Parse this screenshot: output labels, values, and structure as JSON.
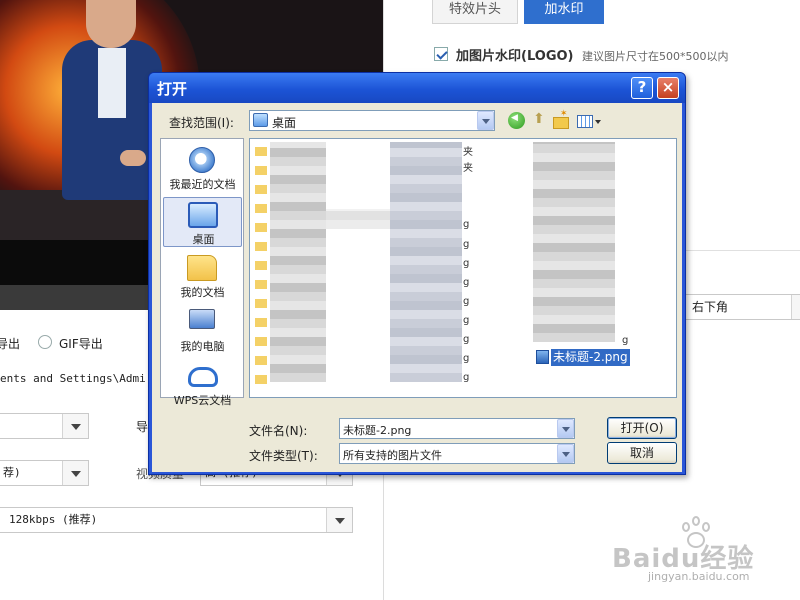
{
  "right_panel": {
    "tabs": [
      {
        "label": "特效片头",
        "active": false
      },
      {
        "label": "加水印",
        "active": true
      }
    ],
    "logo_watermark_label": "加图片水印(LOGO)",
    "logo_watermark_checked": true,
    "logo_hint": "建议图片尺寸在500*500以内",
    "position_value": "右下角"
  },
  "export": {
    "video_export_label_fragment": "导出",
    "gif_export_label": "GIF导出",
    "path_value": "ents and Settings\\Admi",
    "right_label_fragment": "导",
    "video_quality_value": "荐)",
    "video_setting_label": "视频质量",
    "video_setting_value": "高 (推荐)",
    "audio_quality_value": "128kbps (推荐)"
  },
  "dialog": {
    "title": "打开",
    "help_label": "?",
    "close_label": "×",
    "look_in_label": "查找范围(I):",
    "look_in_value": "桌面",
    "places": [
      {
        "label": "我最近的文档",
        "icon": "recent-docs-icon"
      },
      {
        "label": "桌面",
        "icon": "desktop-icon",
        "selected": true
      },
      {
        "label": "我的文档",
        "icon": "my-documents-icon"
      },
      {
        "label": "我的电脑",
        "icon": "my-computer-icon"
      },
      {
        "label": "WPS云文档",
        "icon": "wps-cloud-icon"
      }
    ],
    "file_fragments": [
      "夹",
      "夹",
      "g",
      "g",
      "g",
      "g",
      "g",
      "g",
      "g",
      "g",
      "g",
      "g"
    ],
    "selected_file": "未标题-2.png",
    "file_name_label": "文件名(N):",
    "file_name_value": "未标题-2.png",
    "file_type_label": "文件类型(T):",
    "file_type_value": "所有支持的图片文件",
    "open_button": "打开(O)",
    "cancel_button": "取消"
  },
  "watermark": {
    "brand": "Baidu经验",
    "site": "jingyan.baidu.com"
  },
  "colors": {
    "xp_title_blue": "#1c54d6",
    "dialog_face": "#ece9d8",
    "selection_blue": "#316ac5",
    "tab_active": "#2f6fce"
  }
}
